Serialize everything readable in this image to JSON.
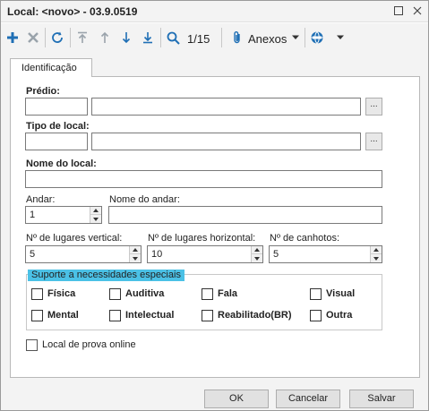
{
  "window": {
    "title": "Local: <novo> - 03.9.0519",
    "restore_icon": "restore-icon",
    "close_icon": "close-icon"
  },
  "toolbar": {
    "pager": "1/15",
    "anexos_label": "Anexos",
    "icons": [
      "add-icon",
      "delete-icon",
      "refresh-icon",
      "first-icon",
      "previous-icon",
      "next-icon",
      "last-icon",
      "search-icon",
      "attachment-icon",
      "chevron-down-icon",
      "globe-icon",
      "chevron-down-icon"
    ]
  },
  "tab": {
    "label": "Identificação"
  },
  "form": {
    "predio_label": "Prédio:",
    "tipo_label": "Tipo de local:",
    "nome_local_label": "Nome do local:",
    "andar_label": "Andar:",
    "andar_value": "1",
    "nome_andar_label": "Nome do andar:",
    "lug_vert_label": "Nº de lugares vertical:",
    "lug_vert_value": "5",
    "lug_horiz_label": "Nº de lugares horizontal:",
    "lug_horiz_value": "10",
    "canhotos_label": "Nº de canhotos:",
    "canhotos_value": "5",
    "ellipsis": "..."
  },
  "suporte": {
    "title": "Suporte a necessidades especiais",
    "options": [
      "Física",
      "Auditiva",
      "Fala",
      "Visual",
      "Mental",
      "Intelectual",
      "Reabilitado(BR)",
      "Outra"
    ]
  },
  "online": {
    "label": "Local de prova online"
  },
  "buttons": {
    "ok": "OK",
    "cancel": "Cancelar",
    "save": "Salvar"
  },
  "colors": {
    "accent_blue": "#1f6fb5",
    "group_title_bg": "#4bc1e6"
  }
}
